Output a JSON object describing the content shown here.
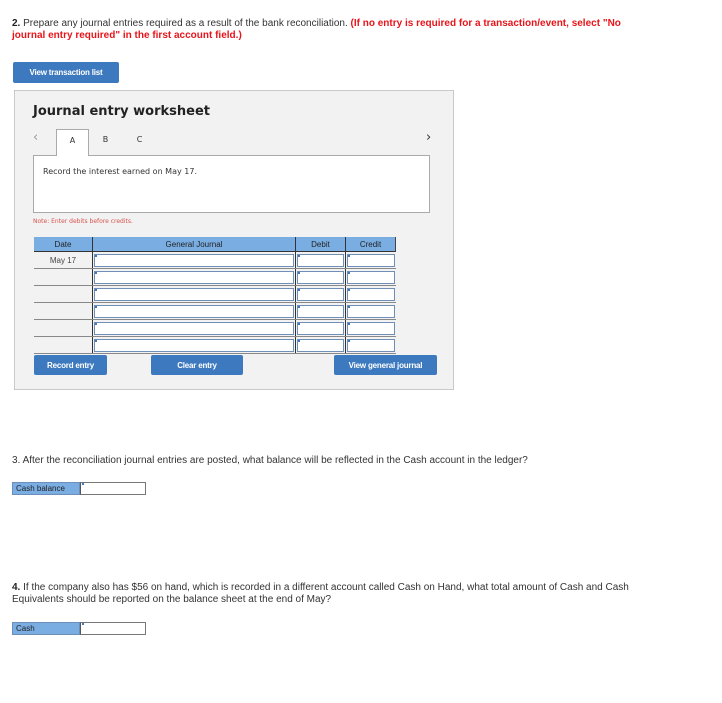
{
  "question2": {
    "number": "2.",
    "text": " Prepare any journal entries required as a result of the bank reconciliation. ",
    "instruction": "(If no entry is required for a transaction/event, select \"No journal entry required\" in the first account field.)"
  },
  "view_transaction_list_label": "View transaction list",
  "worksheet": {
    "title": "Journal entry worksheet",
    "prev_icon": "chevron-left-icon",
    "next_icon": "chevron-right-icon",
    "tabs": [
      {
        "label": "A",
        "active": true
      },
      {
        "label": "B",
        "active": false
      },
      {
        "label": "C",
        "active": false
      }
    ],
    "description": "Record the interest earned on May 17.",
    "note": "Note: Enter debits before credits.",
    "table": {
      "headers": [
        "Date",
        "General Journal",
        "Debit",
        "Credit"
      ],
      "rows": [
        {
          "date": "May 17",
          "account": "",
          "debit": "",
          "credit": ""
        },
        {
          "date": "",
          "account": "",
          "debit": "",
          "credit": ""
        },
        {
          "date": "",
          "account": "",
          "debit": "",
          "credit": ""
        },
        {
          "date": "",
          "account": "",
          "debit": "",
          "credit": ""
        },
        {
          "date": "",
          "account": "",
          "debit": "",
          "credit": ""
        },
        {
          "date": "",
          "account": "",
          "debit": "",
          "credit": ""
        }
      ]
    },
    "buttons": {
      "record": "Record entry",
      "clear": "Clear entry",
      "view_journal": "View general journal"
    }
  },
  "question3": {
    "text": "3. After the reconciliation journal entries are posted, what balance will be reflected in the Cash account in the ledger?",
    "answer_label": "Cash balance",
    "answer_value": ""
  },
  "question4": {
    "number": "4.",
    "text": " If the company also has $56 on hand, which is recorded in a different account called Cash on Hand, what total amount of Cash and Cash Equivalents should be reported on the balance sheet at the end of May?",
    "answer_label": "Cash",
    "answer_value": ""
  },
  "colors": {
    "button_blue": "#3d79bf",
    "header_blue": "#7aaee3",
    "instruction_red": "#e8141a",
    "note_red": "#d9534f"
  }
}
